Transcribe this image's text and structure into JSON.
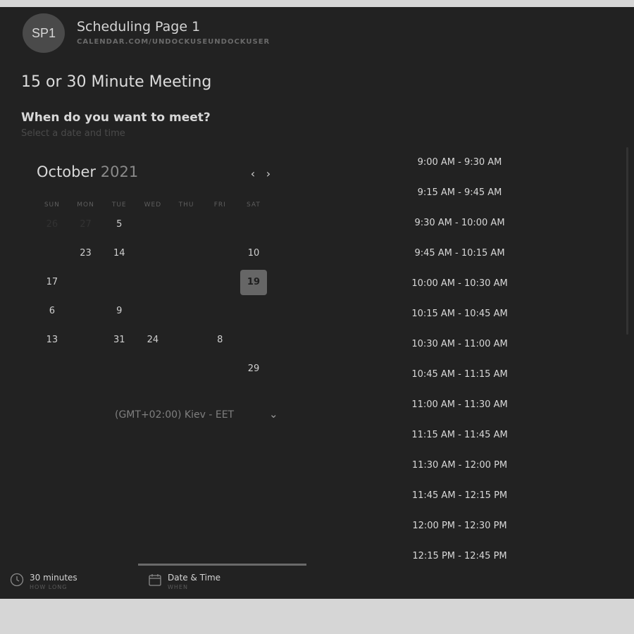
{
  "header": {
    "avatar_initials": "SP1",
    "title": "Scheduling Page 1",
    "url": "CALENDAR.COM/UNDOCKUSEUNDOCKUSER"
  },
  "meeting": {
    "title": "15 or 30 Minute Meeting",
    "question": "When do you want to meet?",
    "subtitle": "Select a date and time"
  },
  "calendar": {
    "month": "October",
    "year": "2021",
    "prev_icon": "chevron-left-icon",
    "next_icon": "chevron-right-icon",
    "weekdays": [
      "SUN",
      "MON",
      "TUE",
      "WED",
      "THU",
      "FRI",
      "SAT"
    ],
    "weeks": [
      [
        {
          "t": "26",
          "m": true
        },
        {
          "t": "27",
          "m": true
        },
        {
          "t": "5",
          "m": false
        },
        {
          "t": "",
          "m": true
        },
        {
          "t": "",
          "m": true
        },
        {
          "t": "",
          "m": true
        },
        {
          "t": "",
          "m": true
        }
      ],
      [
        {
          "t": "",
          "m": true
        },
        {
          "t": "23",
          "m": false
        },
        {
          "t": "14",
          "m": false
        },
        {
          "t": "",
          "m": true
        },
        {
          "t": "",
          "m": true
        },
        {
          "t": "",
          "m": true
        },
        {
          "t": "10",
          "m": false
        }
      ],
      [
        {
          "t": "17",
          "m": false
        },
        {
          "t": "",
          "m": true
        },
        {
          "t": "",
          "m": true
        },
        {
          "t": "",
          "m": true
        },
        {
          "t": "",
          "m": true
        },
        {
          "t": "",
          "m": true
        },
        {
          "t": "19",
          "m": false,
          "selected": true
        }
      ],
      [
        {
          "t": "6",
          "m": false
        },
        {
          "t": "",
          "m": true
        },
        {
          "t": "9",
          "m": false
        },
        {
          "t": "",
          "m": true
        },
        {
          "t": "",
          "m": true
        },
        {
          "t": "",
          "m": true
        },
        {
          "t": "",
          "m": true
        }
      ],
      [
        {
          "t": "13",
          "m": false
        },
        {
          "t": "",
          "m": true
        },
        {
          "t": "31",
          "m": false
        },
        {
          "t": "24",
          "m": false
        },
        {
          "t": "",
          "m": true
        },
        {
          "t": "8",
          "m": false
        },
        {
          "t": "",
          "m": true
        }
      ],
      [
        {
          "t": "",
          "m": true
        },
        {
          "t": "",
          "m": true
        },
        {
          "t": "",
          "m": true
        },
        {
          "t": "",
          "m": true
        },
        {
          "t": "",
          "m": true
        },
        {
          "t": "",
          "m": true
        },
        {
          "t": "29",
          "m": false
        }
      ]
    ],
    "timezone": "(GMT+02:00) Kiev - EET",
    "timezone_icon": "chevron-down-icon"
  },
  "time_slots": [
    "9:00 AM - 9:30 AM",
    "9:15 AM - 9:45 AM",
    "9:30 AM - 10:00 AM",
    "9:45 AM - 10:15 AM",
    "10:00 AM - 10:30 AM",
    "10:15 AM - 10:45 AM",
    "10:30 AM - 11:00 AM",
    "10:45 AM - 11:15 AM",
    "11:00 AM - 11:30 AM",
    "11:15 AM - 11:45 AM",
    "11:30 AM - 12:00 PM",
    "11:45 AM - 12:15 PM",
    "12:00 PM - 12:30 PM",
    "12:15 PM - 12:45 PM"
  ],
  "steps": [
    {
      "label": "30 minutes",
      "sublabel": "HOW LONG",
      "icon": "clock-icon"
    },
    {
      "label": "Date & Time",
      "sublabel": "WHEN",
      "icon": "calendar-icon"
    },
    {
      "label": "",
      "sublabel": "",
      "icon": ""
    },
    {
      "label": "",
      "sublabel": "",
      "icon": ""
    }
  ]
}
